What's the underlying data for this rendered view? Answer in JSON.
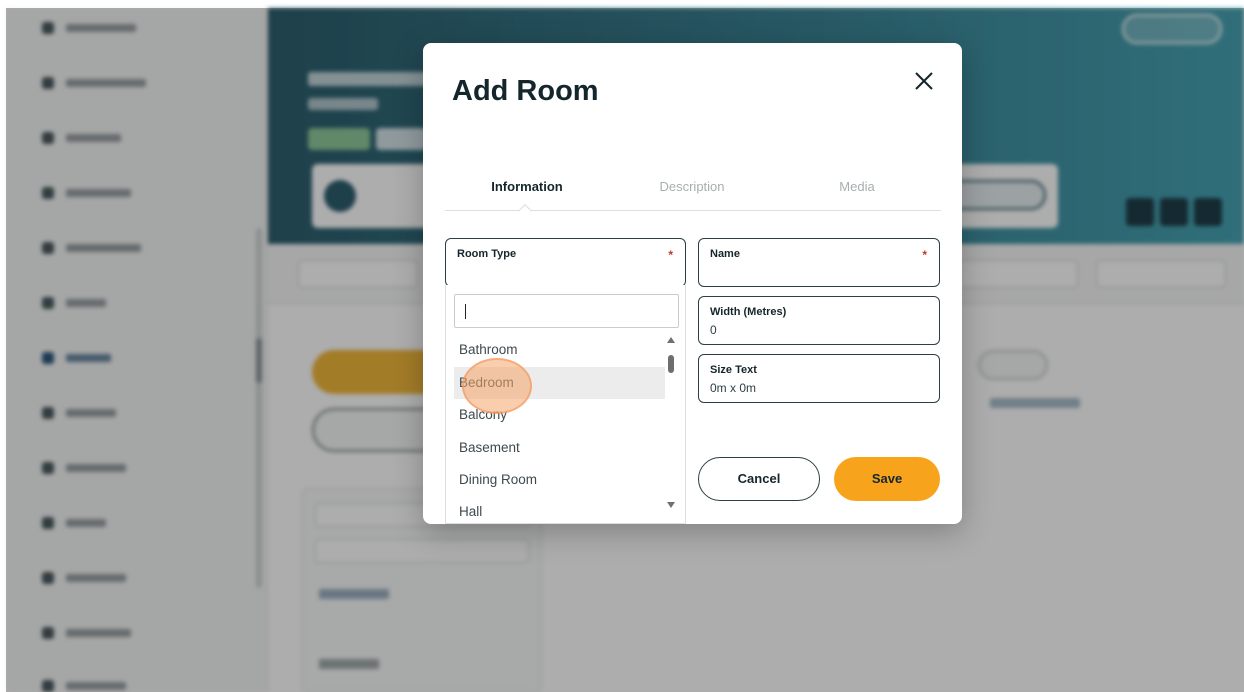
{
  "modal": {
    "title": "Add Room",
    "tabs": [
      {
        "label": "Information",
        "active": true
      },
      {
        "label": "Description",
        "active": false
      },
      {
        "label": "Media",
        "active": false
      }
    ],
    "fields": {
      "room_type": {
        "label": "Room Type",
        "required_mark": "*",
        "value": ""
      },
      "name": {
        "label": "Name",
        "required_mark": "*",
        "value": ""
      },
      "width": {
        "label": "Width (Metres)",
        "value": "0"
      },
      "size_text": {
        "label": "Size Text",
        "value": "0m x 0m"
      }
    },
    "dropdown": {
      "search_value": "",
      "options": [
        "Bathroom",
        "Bedroom",
        "Balcony",
        "Basement",
        "Dining Room",
        "Hall"
      ],
      "hovered_option": "Bedroom"
    },
    "buttons": {
      "cancel_label": "Cancel",
      "save_label": "Save"
    }
  },
  "colors": {
    "accent": "#f7a41c",
    "header_gradient_start": "#2d5f6e",
    "header_gradient_end": "#47a4b4",
    "text_dark": "#14262c",
    "required": "#c0392b",
    "click_marker": "#f5a669"
  },
  "icons": {
    "close": "close-icon",
    "scroll_up": "chevron-up-icon",
    "scroll_down": "chevron-down-icon"
  }
}
